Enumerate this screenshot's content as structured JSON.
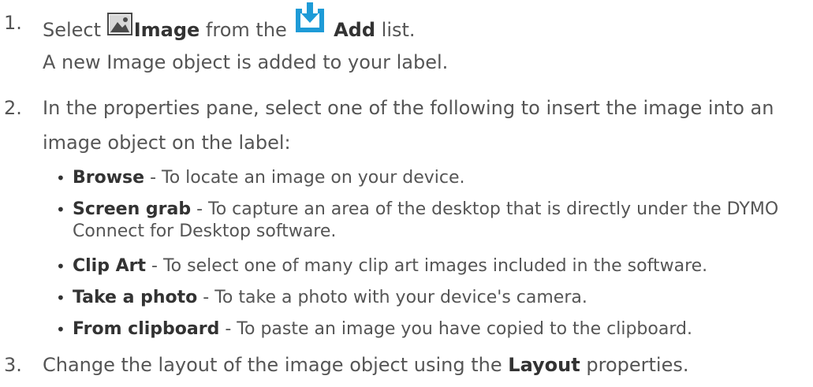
{
  "steps": [
    {
      "number": "1.",
      "parts": {
        "select": "Select",
        "image": "Image",
        "from_the": "from the",
        "add": "Add",
        "list": "list."
      },
      "followup": "A new Image object is added to your label."
    },
    {
      "number": "2.",
      "line1": "In the properties pane, select one of the following to insert the image into an",
      "line2": "image object on the label:",
      "options": [
        {
          "name": "Browse",
          "desc": " - To locate an image on your device."
        },
        {
          "name": "Screen grab",
          "desc": " - To capture an area of the desktop that is directly under the DYMO Connect for Desktop software."
        },
        {
          "name": "Clip Art",
          "desc": " - To select one of many clip art images included in the software."
        },
        {
          "name": "Take a photo",
          "desc": " - To take a photo with your device's camera."
        },
        {
          "name": "From clipboard",
          "desc": " - To paste an image you have copied to the clipboard."
        }
      ]
    },
    {
      "number": "3.",
      "parts": {
        "before": "Change the layout of the image object using the",
        "layout": "Layout",
        "after": "properties."
      }
    }
  ],
  "icons": {
    "image_icon": "image-icon",
    "add_icon": "add-download-icon"
  },
  "colors": {
    "body_text": "#555555",
    "ui_term": "#333333",
    "add_icon_blue": "#1E9BD7"
  }
}
